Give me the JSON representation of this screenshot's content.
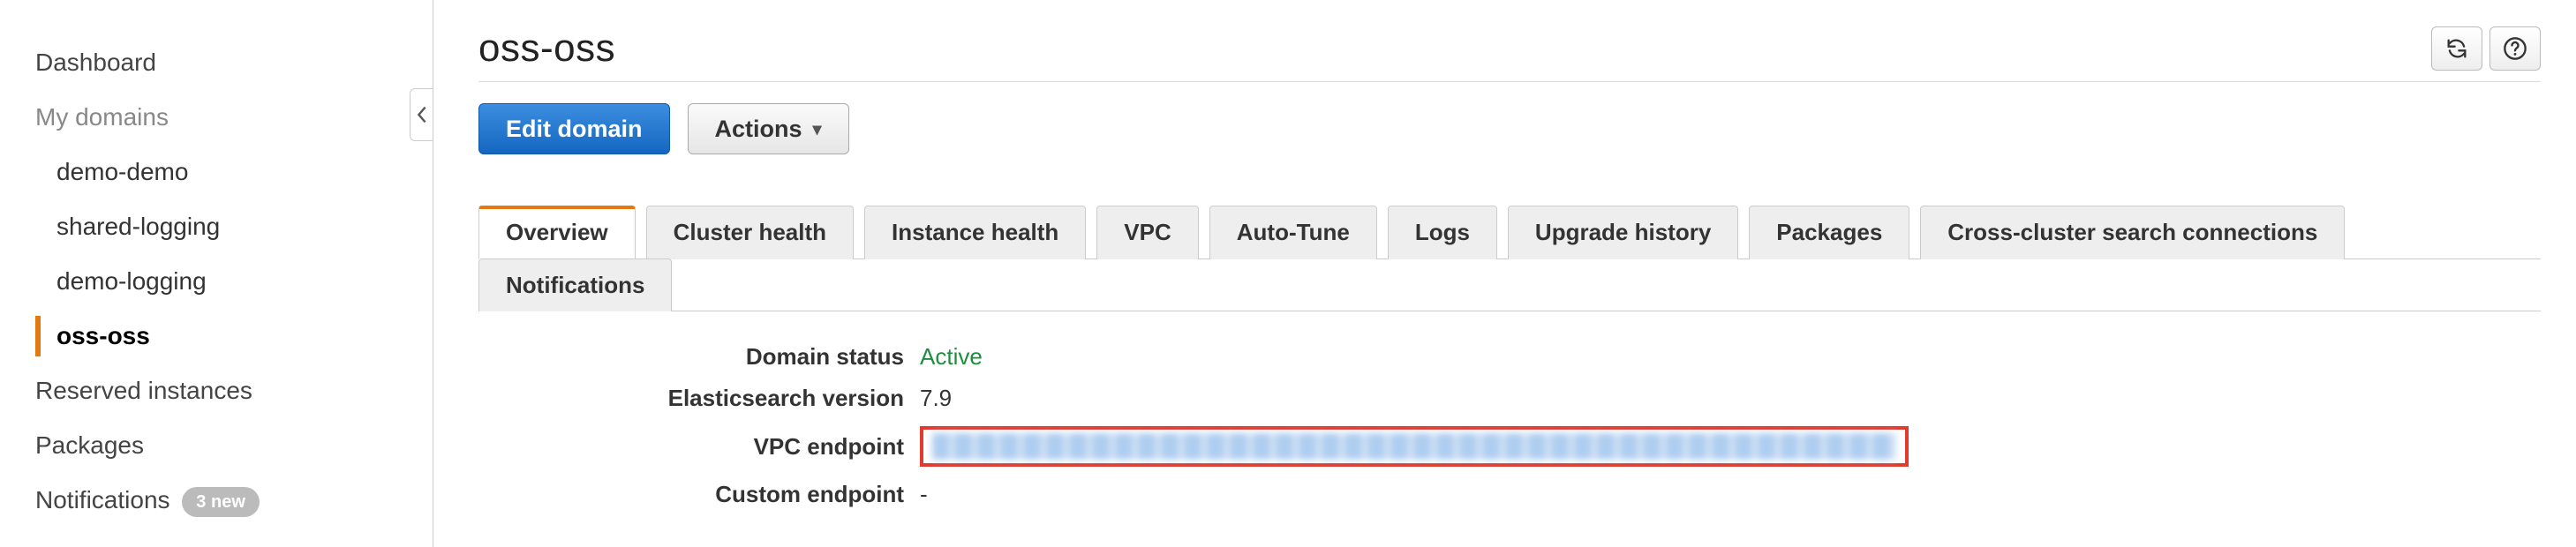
{
  "sidebar": {
    "items": [
      {
        "label": "Dashboard",
        "kind": "top"
      },
      {
        "label": "My domains",
        "kind": "section"
      },
      {
        "label": "demo-demo",
        "kind": "child"
      },
      {
        "label": "shared-logging",
        "kind": "child"
      },
      {
        "label": "demo-logging",
        "kind": "child"
      },
      {
        "label": "oss-oss",
        "kind": "child-active"
      },
      {
        "label": "Reserved instances",
        "kind": "top"
      },
      {
        "label": "Packages",
        "kind": "top"
      },
      {
        "label": "Notifications",
        "kind": "top",
        "badge": "3 new"
      }
    ]
  },
  "header": {
    "title": "oss-oss"
  },
  "toolbar": {
    "edit_label": "Edit domain",
    "actions_label": "Actions"
  },
  "tabs": [
    "Overview",
    "Cluster health",
    "Instance health",
    "VPC",
    "Auto-Tune",
    "Logs",
    "Upgrade history",
    "Packages",
    "Cross-cluster search connections",
    "Notifications"
  ],
  "details": {
    "domain_status_label": "Domain status",
    "domain_status_value": "Active",
    "es_version_label": "Elasticsearch version",
    "es_version_value": "7.9",
    "vpc_endpoint_label": "VPC endpoint",
    "custom_endpoint_label": "Custom endpoint",
    "custom_endpoint_value": "-"
  }
}
